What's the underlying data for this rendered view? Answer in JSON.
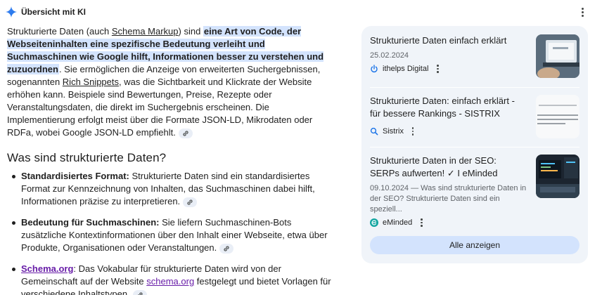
{
  "header": {
    "title": "Übersicht mit KI",
    "icon": "gemini-sparkle-icon"
  },
  "intro": {
    "p1": "Strukturierte Daten (auch ",
    "link1": "Schema Markup",
    "p2": ") sind ",
    "highlight": "eine Art von Code, der Webseiteninhalten eine spezifische Bedeutung verleiht und Suchmaschinen wie Google hilft, Informationen besser zu verstehen und zuzuordnen",
    "p3": ". Sie ermöglichen die Anzeige von erweiterten Suchergebnissen, sogenannten ",
    "link2": "Rich Snippets",
    "p4": ", was die Sichtbarkeit und Klickrate der Website erhöhen kann. Beispiele sind Bewertungen, Preise, Rezepte oder Veranstaltungsdaten, die direkt im Suchergebnis erscheinen. Die Implementierung erfolgt meist über die Formate JSON-LD, Mikrodaten oder RDFa, wobei Google JSON-LD empfiehlt."
  },
  "section_heading": "Was sind strukturierte Daten?",
  "bullets": [
    {
      "term": "Standardisiertes Format:",
      "text": " Strukturierte Daten sind ein standardisiertes Format zur Kennzeichnung von Inhalten, das Suchmaschinen dabei hilft, Informationen präzise zu interpretieren."
    },
    {
      "term": "Bedeutung für Suchmaschinen:",
      "text": " Sie liefern Suchmaschinen-Bots zusätzliche Kontextinformationen über den Inhalt einer Webseite, etwa über Produkte, Organisationen oder Veranstaltungen."
    },
    {
      "term": "Schema.org",
      "text_a": ": Das Vokabular für strukturierte Daten wird von der Gemeinschaft auf der Website ",
      "link": "schema.org",
      "text_b": " festgelegt und bietet Vorlagen für verschiedene Inhaltstypen."
    }
  ],
  "sources": [
    {
      "title": "Strukturierte Daten einfach erklärt",
      "date": "25.02.2024",
      "source": "ithelps Digital",
      "icon": "power-icon"
    },
    {
      "title": "Strukturierte Daten: einfach erklärt - für bessere Rankings - SISTRIX",
      "source": "Sistrix",
      "icon": "magnifier-icon"
    },
    {
      "title": "Strukturierte Daten in der SEO: SERPs aufwerten! ✓ I eMinded",
      "snippet": "09.10.2024 — Was sind strukturierte Daten in der SEO? Strukturierte Daten sind ein speziell...",
      "source": "eMinded",
      "icon": "eminded-logo-icon"
    }
  ],
  "show_all": "Alle anzeigen",
  "colors": {
    "highlight": "#d3e3fd",
    "panel": "#f0f4f9",
    "link_visited": "#681da8",
    "button": "#d3e3fd"
  }
}
